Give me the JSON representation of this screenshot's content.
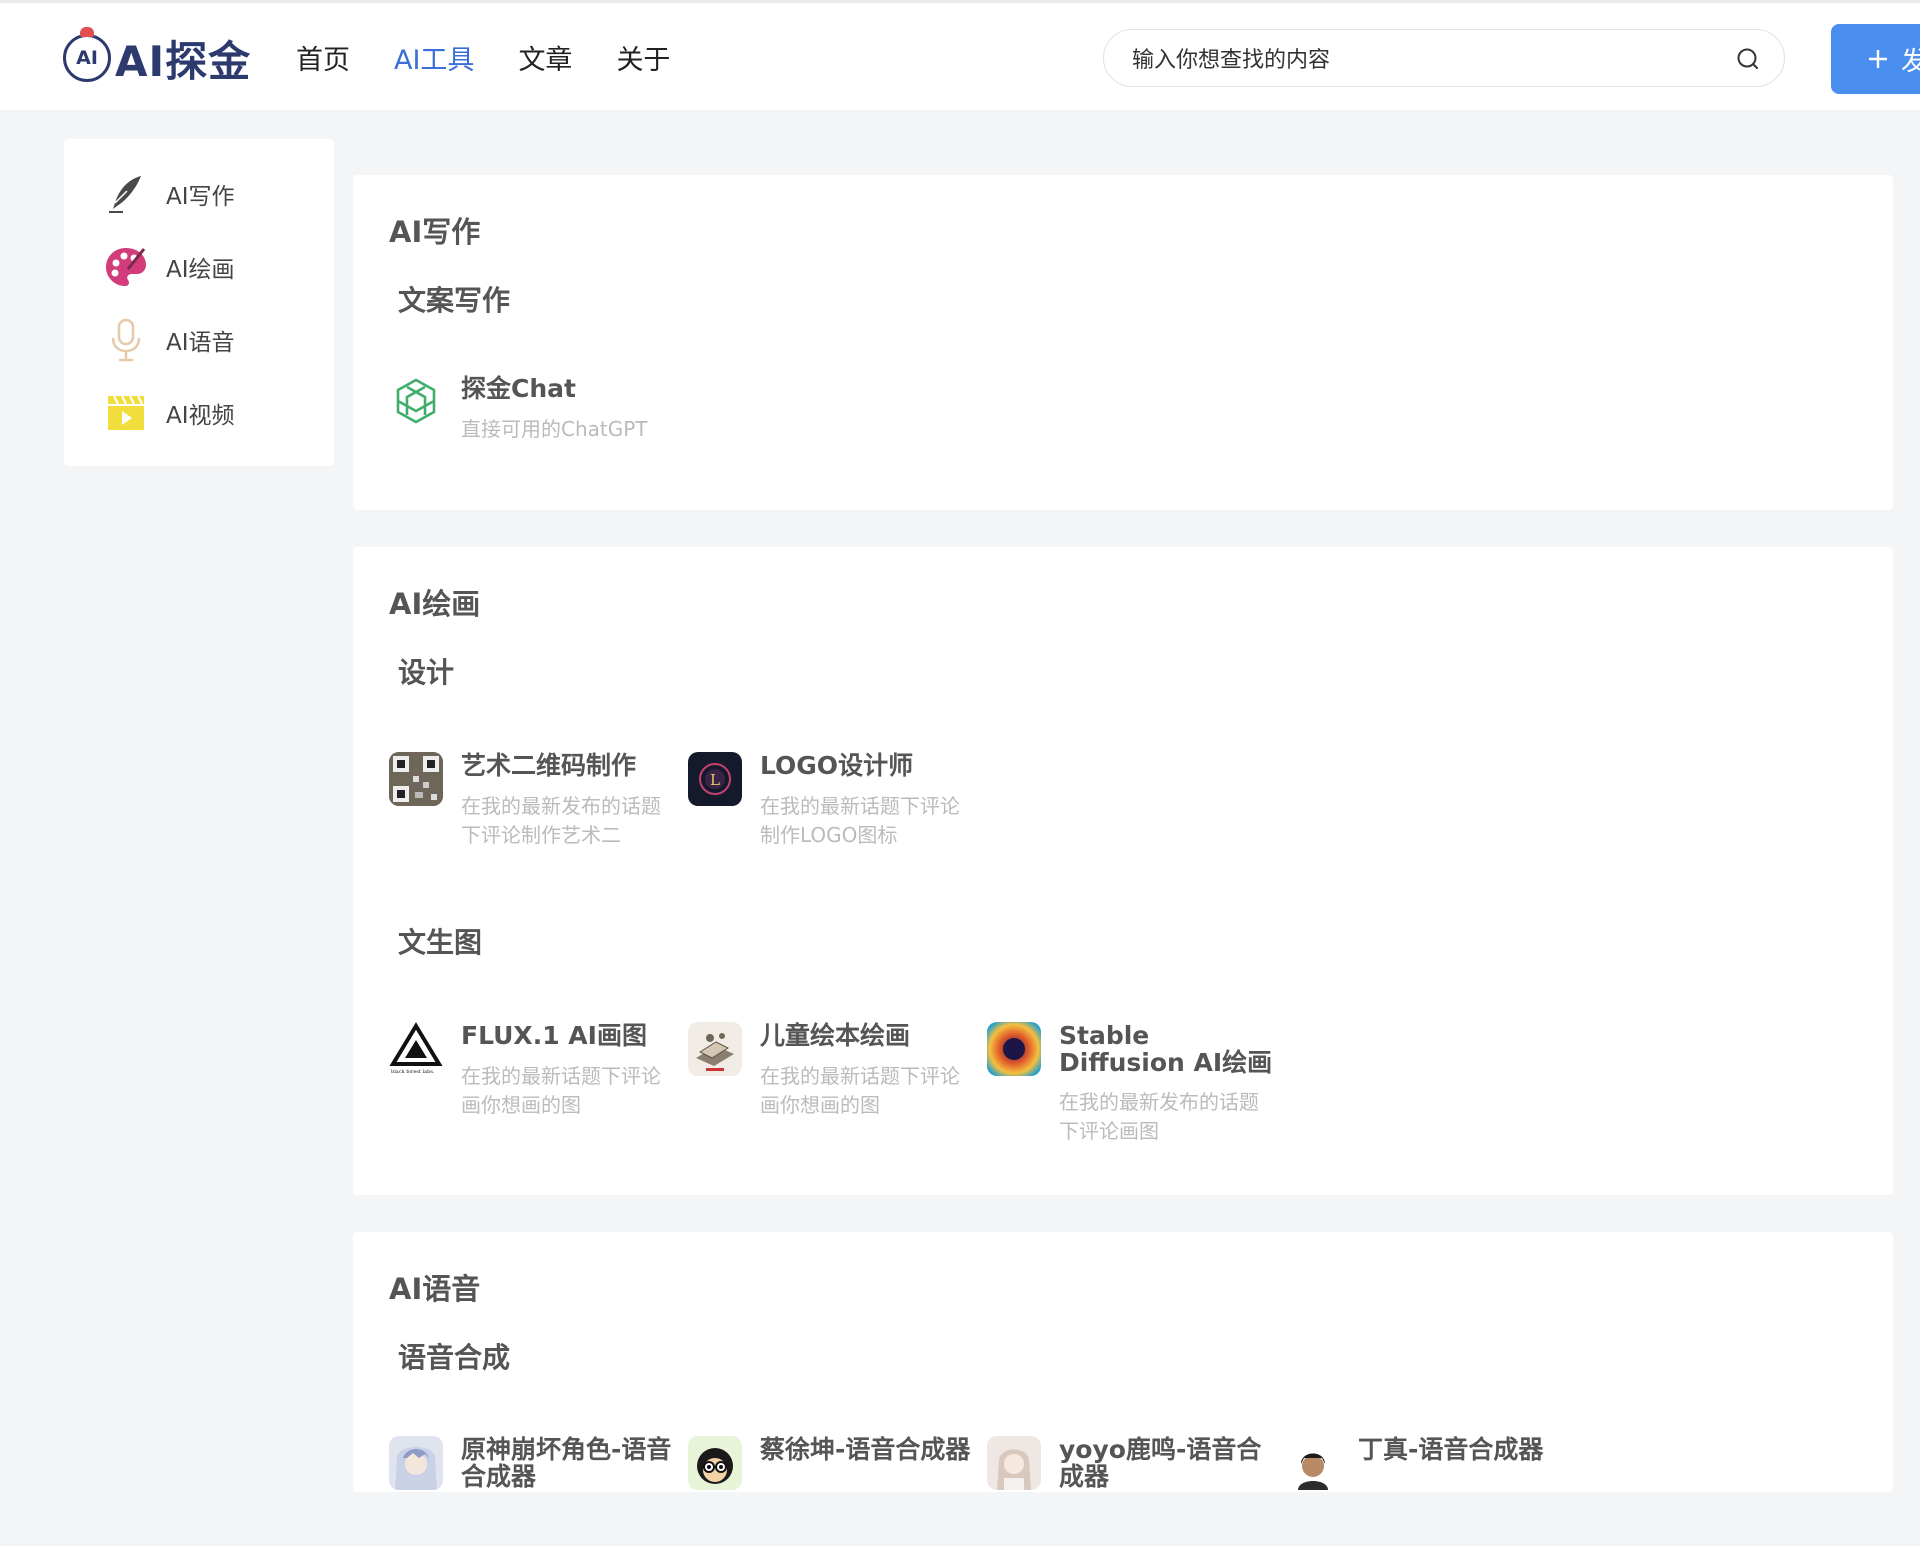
{
  "header": {
    "logo_text": "AI探金",
    "logo_badge": "AI",
    "nav": [
      "首页",
      "AI工具",
      "文章",
      "关于"
    ],
    "active_nav": "AI工具",
    "search_placeholder": "输入你想查找的内容",
    "publish_label": "发",
    "publish_icon": "plus-icon"
  },
  "sidebar": {
    "items": [
      {
        "label": "AI写作",
        "icon": "quill-icon"
      },
      {
        "label": "AI绘画",
        "icon": "palette-icon"
      },
      {
        "label": "AI语音",
        "icon": "microphone-icon"
      },
      {
        "label": "AI视频",
        "icon": "video-clapper-icon"
      }
    ]
  },
  "sections": [
    {
      "title": "AI写作",
      "groups": [
        {
          "title": "文案写作",
          "tools": [
            {
              "name": "探金Chat",
              "desc": "直接可用的ChatGPT",
              "icon": "openai-logo-icon"
            }
          ]
        }
      ]
    },
    {
      "title": "AI绘画",
      "groups": [
        {
          "title": "设计",
          "tools": [
            {
              "name": "艺术二维码制作",
              "desc": "在我的最新发布的话题下评论制作艺术二",
              "icon": "qr-code-icon"
            },
            {
              "name": "LOGO设计师",
              "desc": "在我的最新话题下评论制作LOGO图标",
              "icon": "logo-designer-icon"
            }
          ]
        },
        {
          "title": "文生图",
          "tools": [
            {
              "name": "FLUX.1 AI画图",
              "desc": "在我的最新话题下评论画你想画的图",
              "icon": "black-forest-labs-icon",
              "icon_caption": "black forest labs."
            },
            {
              "name": "儿童绘本绘画",
              "desc": "在我的最新话题下评论画你想画的图",
              "icon": "picture-book-icon"
            },
            {
              "name": "Stable Diffusion AI绘画",
              "desc": "在我的最新发布的话题下评论画图",
              "icon": "stable-diffusion-icon"
            }
          ]
        }
      ]
    },
    {
      "title": "AI语音",
      "groups": [
        {
          "title": "语音合成",
          "tools": [
            {
              "name": "原神崩坏角色-语音合成器",
              "icon": "anime-avatar-icon"
            },
            {
              "name": "蔡徐坤-语音合成器",
              "icon": "cartoon-avatar-icon"
            },
            {
              "name": "yoyo鹿鸣-语音合成器",
              "icon": "girl-avatar-icon"
            },
            {
              "name": "丁真-语音合成器",
              "icon": "boy-avatar-icon"
            }
          ]
        }
      ]
    }
  ],
  "colors": {
    "accent": "#3a6fd8",
    "publish_button": "#4a8ef0",
    "logo": "#2d3a6e",
    "page_bg": "#f4f5f7"
  }
}
